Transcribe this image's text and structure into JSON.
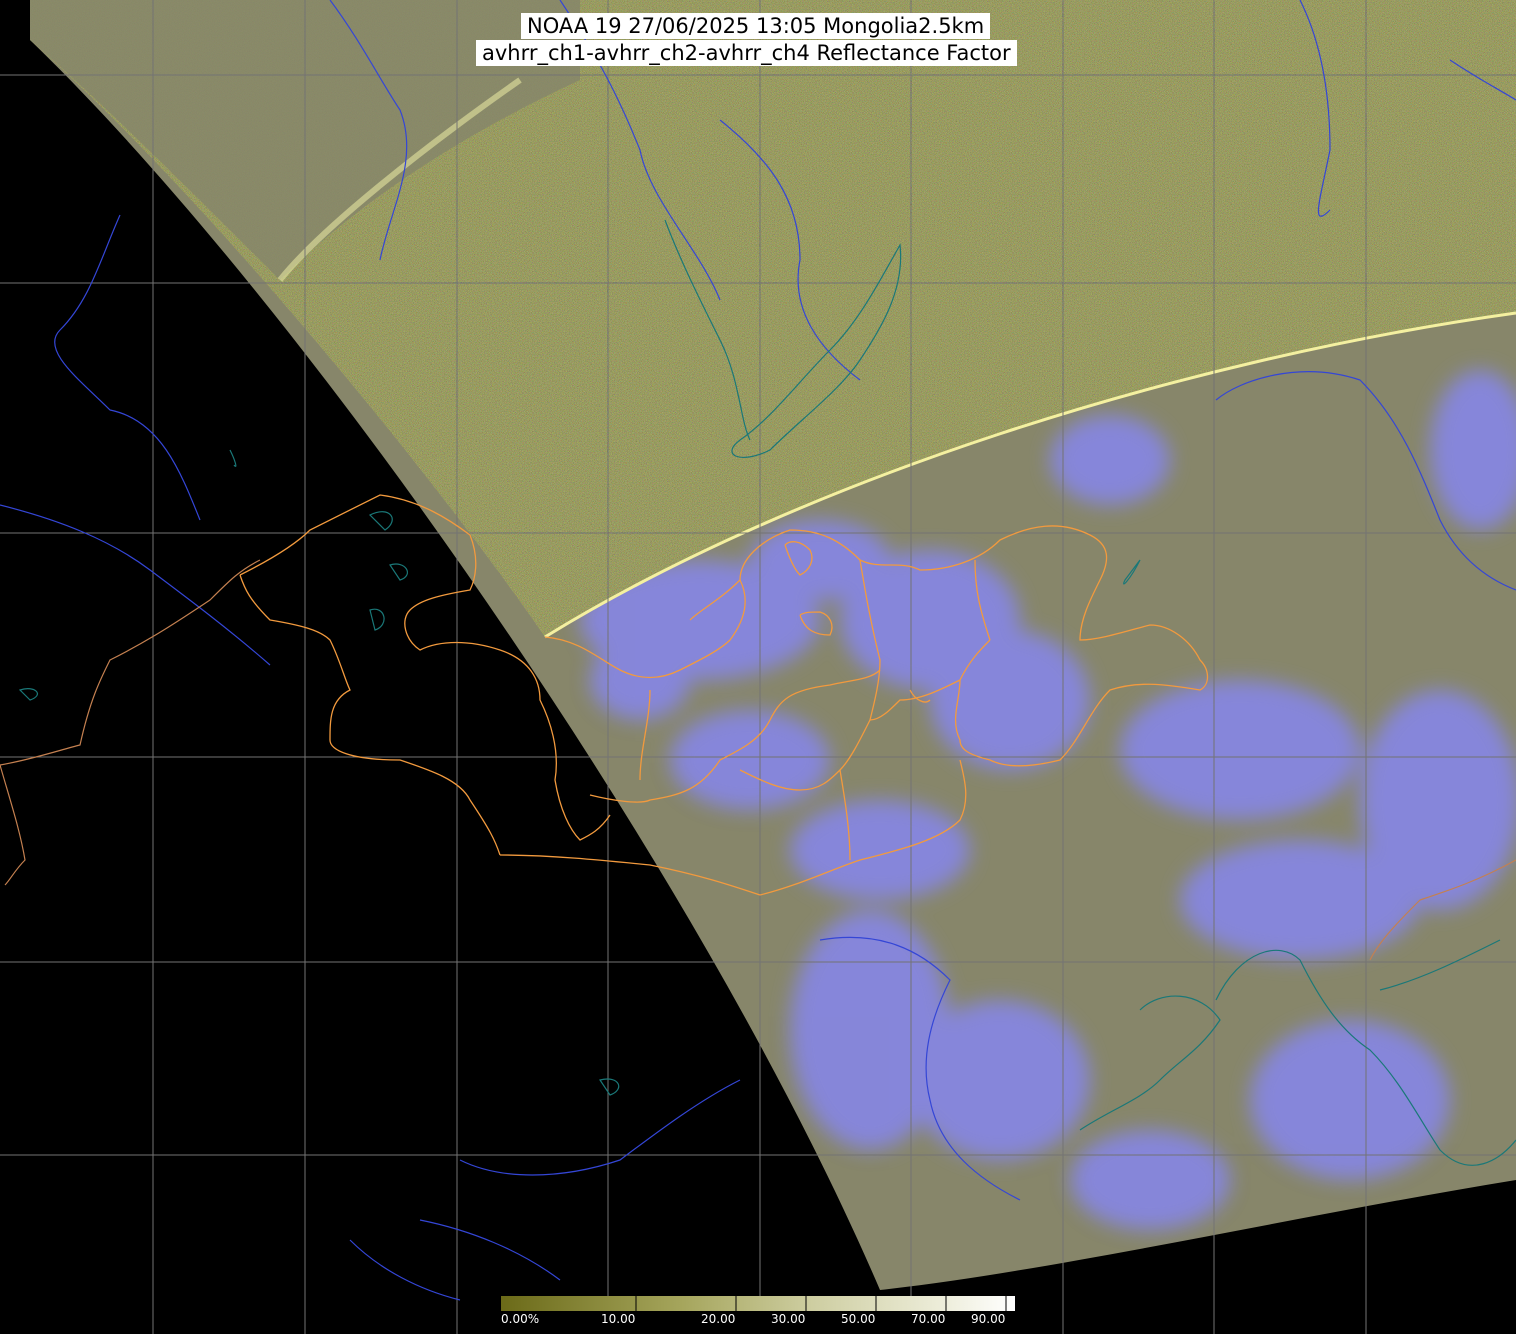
{
  "title": {
    "line1": "NOAA 19 27/06/2025 13:05 Mongolia2.5km",
    "line2": "avhrr_ch1-avhrr_ch2-avhrr_ch4 Reflectance Factor"
  },
  "colorbar": {
    "labels": [
      "0.00%",
      "10.00",
      "20.00",
      "30.00",
      "50.00",
      "70.00",
      "90.00"
    ],
    "ticks": [
      0,
      10,
      20,
      30,
      50,
      70,
      90
    ],
    "colors": [
      "#6b6a18",
      "#8a8a3a",
      "#a5a55c",
      "#c0c084",
      "#d5d5ac",
      "#e8e8d0",
      "#ffffff"
    ]
  },
  "colors": {
    "background": "#000000",
    "land_fill": "#8a8a6c",
    "noise_fill": "#a8a86a",
    "cloud": "#8a8ae6",
    "grid": "#777777",
    "river": "#3344cc",
    "coast": "#1b7a7a",
    "admin_border": "#f0903a",
    "international_border": "#d88a50"
  }
}
